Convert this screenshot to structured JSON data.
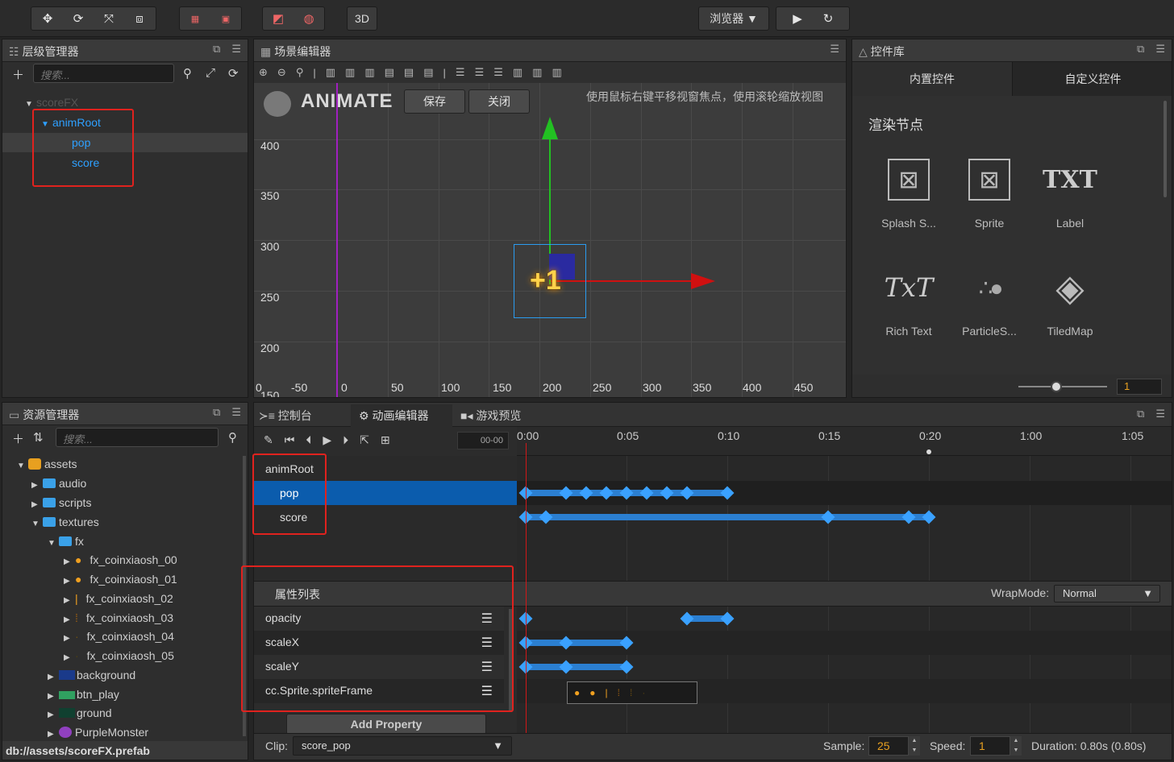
{
  "toolbar": {
    "tools": [
      "move-icon",
      "rotate-icon",
      "scale-icon",
      "rect-icon"
    ],
    "mode_3d": "3D",
    "browser_label": "浏览器 ▼",
    "play_icon": "play-icon",
    "refresh_icon": "refresh-icon"
  },
  "hierarchy": {
    "title": "层级管理器",
    "search_placeholder": "搜索...",
    "nodes": [
      {
        "label": "scoreFX"
      },
      {
        "label": "animRoot"
      },
      {
        "label": "pop"
      },
      {
        "label": "score"
      }
    ]
  },
  "scene": {
    "title": "场景编辑器",
    "animate_label": "ANIMATE",
    "save_label": "保存",
    "close_label": "关闭",
    "hint": "使用鼠标右键平移视窗焦点，使用滚轮缩放视图",
    "y_ticks": [
      "400",
      "350",
      "300",
      "250",
      "200",
      "150"
    ],
    "x_ticks": [
      "0",
      "-50",
      "0",
      "50",
      "100",
      "150",
      "200",
      "250",
      "300",
      "350",
      "400",
      "450"
    ],
    "sprite_text": "+1"
  },
  "library": {
    "title": "控件库",
    "tab_builtin": "内置控件",
    "tab_custom": "自定义控件",
    "section": "渲染节点",
    "widgets": [
      {
        "label": "Splash S..."
      },
      {
        "label": "Sprite"
      },
      {
        "label": "Label"
      },
      {
        "label": "Rich Text"
      },
      {
        "label": "ParticleS..."
      },
      {
        "label": "TiledMap"
      }
    ],
    "label_icon_text": "TXT",
    "richtext_icon_text": "TxT",
    "zoom_value": "1"
  },
  "assets": {
    "title": "资源管理器",
    "search_placeholder": "搜索...",
    "items": [
      {
        "label": "assets"
      },
      {
        "label": "audio"
      },
      {
        "label": "scripts"
      },
      {
        "label": "textures"
      },
      {
        "label": "fx"
      },
      {
        "label": "fx_coinxiaosh_00"
      },
      {
        "label": "fx_coinxiaosh_01"
      },
      {
        "label": "fx_coinxiaosh_02"
      },
      {
        "label": "fx_coinxiaosh_03"
      },
      {
        "label": "fx_coinxiaosh_04"
      },
      {
        "label": "fx_coinxiaosh_05"
      },
      {
        "label": "background"
      },
      {
        "label": "btn_play"
      },
      {
        "label": "ground"
      },
      {
        "label": "PurpleMonster"
      }
    ],
    "status_path": "db://assets/scoreFX.prefab"
  },
  "bottom_tabs": {
    "console": "控制台",
    "animation": "动画编辑器",
    "preview": "游戏预览"
  },
  "animation": {
    "time_display": "00-00",
    "ruler": [
      "0:00",
      "0:05",
      "0:10",
      "0:15",
      "0:20",
      "1:00",
      "1:05"
    ],
    "nodes": [
      {
        "label": "animRoot"
      },
      {
        "label": "pop"
      },
      {
        "label": "score"
      }
    ],
    "props_header": "属性列表",
    "wrapmode_label": "WrapMode:",
    "wrapmode_value": "Normal",
    "properties": [
      {
        "label": "opacity"
      },
      {
        "label": "scaleX"
      },
      {
        "label": "scaleY"
      },
      {
        "label": "cc.Sprite.spriteFrame"
      }
    ],
    "add_property": "Add Property",
    "clip_label": "Clip:",
    "clip_value": "score_pop",
    "sample_label": "Sample:",
    "sample_value": "25",
    "speed_label": "Speed:",
    "speed_value": "1",
    "duration": "Duration: 0.80s (0.80s)"
  },
  "colors": {
    "accent": "#2ea0ff",
    "keyframe": "#3aa1ff",
    "highlight": "#e0221e"
  }
}
